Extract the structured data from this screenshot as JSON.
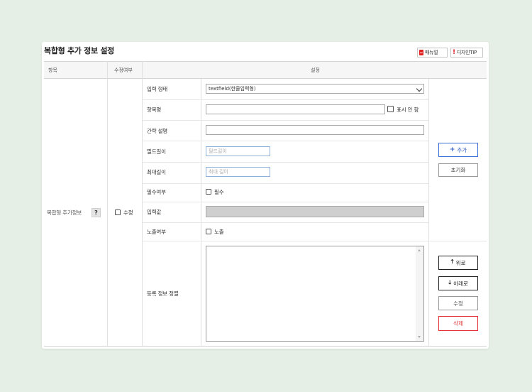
{
  "page": {
    "title": "복합형 추가 정보 설정",
    "manual_label": "매뉴얼",
    "tip_label": "디자인TIP"
  },
  "table": {
    "headers": {
      "item": "항목",
      "editable": "수정여부",
      "settings": "설정"
    },
    "row_label": "복합형 추가정보",
    "help_label": "?",
    "edit_checkbox_label": "수정"
  },
  "form": {
    "input_type": {
      "label": "입력 형태",
      "value": "textfield(한줄입력형)"
    },
    "item_name": {
      "label": "항목명",
      "value": "",
      "hide_label": "표시 안 함"
    },
    "brief_desc": {
      "label": "간략 설명",
      "value": ""
    },
    "field_length": {
      "label": "필드길이",
      "placeholder": "필드길이"
    },
    "max_length": {
      "label": "최대길이",
      "placeholder": "최대 길이"
    },
    "required": {
      "label": "필수여부",
      "checkbox_label": "필수"
    },
    "input_value": {
      "label": "입력값",
      "value": ""
    },
    "exposure": {
      "label": "노출여부",
      "checkbox_label": "노출"
    },
    "registered_sort": {
      "label": "등록 정보 정렬"
    }
  },
  "actions": {
    "add_label": "추가",
    "reset_label": "초기화",
    "up_label": "위로",
    "down_label": "아래로",
    "edit_label": "수정",
    "delete_label": "삭제"
  },
  "colors": {
    "accent_blue": "#2b5bc4",
    "danger_red": "#e03030",
    "background": "#e6efe6"
  }
}
